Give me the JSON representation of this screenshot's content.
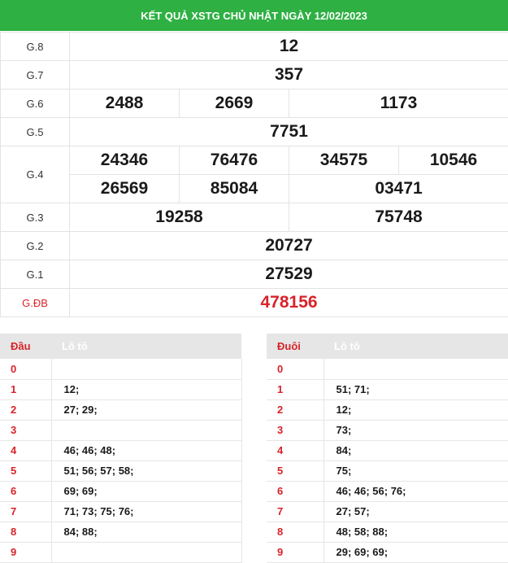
{
  "header": {
    "title": "KẾT QUẢ XSTG CHỦ NHẬT NGÀY 12/02/2023"
  },
  "prizes": {
    "g8": {
      "label": "G.8",
      "numbers": [
        "12"
      ]
    },
    "g7": {
      "label": "G.7",
      "numbers": [
        "357"
      ]
    },
    "g6": {
      "label": "G.6",
      "numbers": [
        "2488",
        "2669",
        "1173"
      ]
    },
    "g5": {
      "label": "G.5",
      "numbers": [
        "7751"
      ]
    },
    "g4": {
      "label": "G.4",
      "numbers": [
        "24346",
        "76476",
        "34575",
        "10546",
        "26569",
        "85084",
        "03471"
      ]
    },
    "g3": {
      "label": "G.3",
      "numbers": [
        "19258",
        "75748"
      ]
    },
    "g2": {
      "label": "G.2",
      "numbers": [
        "20727"
      ]
    },
    "g1": {
      "label": "G.1",
      "numbers": [
        "27529"
      ]
    },
    "gdb": {
      "label": "G.ĐB",
      "numbers": [
        "478156"
      ]
    }
  },
  "loto_dau": {
    "header_key": "Đầu",
    "header_val": "Lô tô",
    "rows": [
      {
        "k": "0",
        "v": ""
      },
      {
        "k": "1",
        "v": "12;"
      },
      {
        "k": "2",
        "v": "27; 29;"
      },
      {
        "k": "3",
        "v": ""
      },
      {
        "k": "4",
        "v": "46; 46; 48;"
      },
      {
        "k": "5",
        "v": "51; 56; 57; 58;"
      },
      {
        "k": "6",
        "v": "69; 69;"
      },
      {
        "k": "7",
        "v": "71; 73; 75; 76;"
      },
      {
        "k": "8",
        "v": "84; 88;"
      },
      {
        "k": "9",
        "v": ""
      }
    ]
  },
  "loto_duoi": {
    "header_key": "Đuôi",
    "header_val": "Lô tô",
    "rows": [
      {
        "k": "0",
        "v": ""
      },
      {
        "k": "1",
        "v": "51; 71;"
      },
      {
        "k": "2",
        "v": "12;"
      },
      {
        "k": "3",
        "v": "73;"
      },
      {
        "k": "4",
        "v": "84;"
      },
      {
        "k": "5",
        "v": "75;"
      },
      {
        "k": "6",
        "v": "46; 46; 56; 76;"
      },
      {
        "k": "7",
        "v": "27; 57;"
      },
      {
        "k": "8",
        "v": "48; 58; 88;"
      },
      {
        "k": "9",
        "v": "29; 69; 69;"
      }
    ]
  },
  "colors": {
    "header_bg": "#2eb043",
    "accent_red": "#d8232a",
    "table_head_bg": "#e6e6e6"
  }
}
